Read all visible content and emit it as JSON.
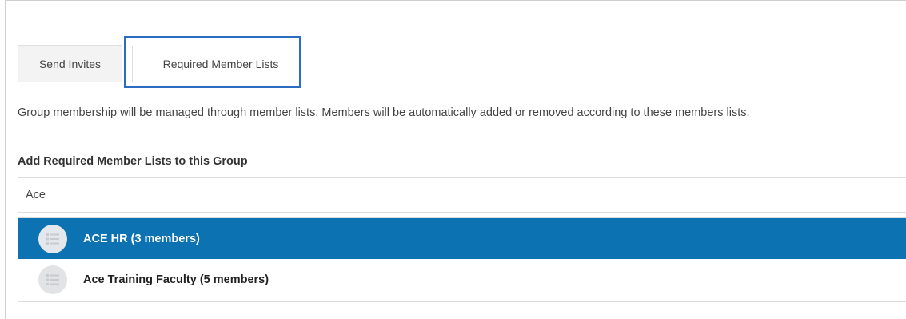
{
  "tabs": [
    {
      "label": "Send Invites",
      "active": false
    },
    {
      "label": "Required Member Lists",
      "active": true
    }
  ],
  "description": "Group membership will be managed through member lists. Members will be automatically added or removed according to these members lists.",
  "section_label": "Add Required Member Lists to this Group",
  "search": {
    "value": "Ace",
    "placeholder": ""
  },
  "results": [
    {
      "label": "ACE HR (3 members)",
      "icon": "member-list-icon",
      "highlighted": true
    },
    {
      "label": "Ace Training Faculty (5 members)",
      "icon": "member-list-icon",
      "highlighted": false
    }
  ],
  "colors": {
    "accent": "#0d72b2",
    "focus_ring": "#2d6cc0",
    "icon_glyph": "#c5cbd1"
  }
}
